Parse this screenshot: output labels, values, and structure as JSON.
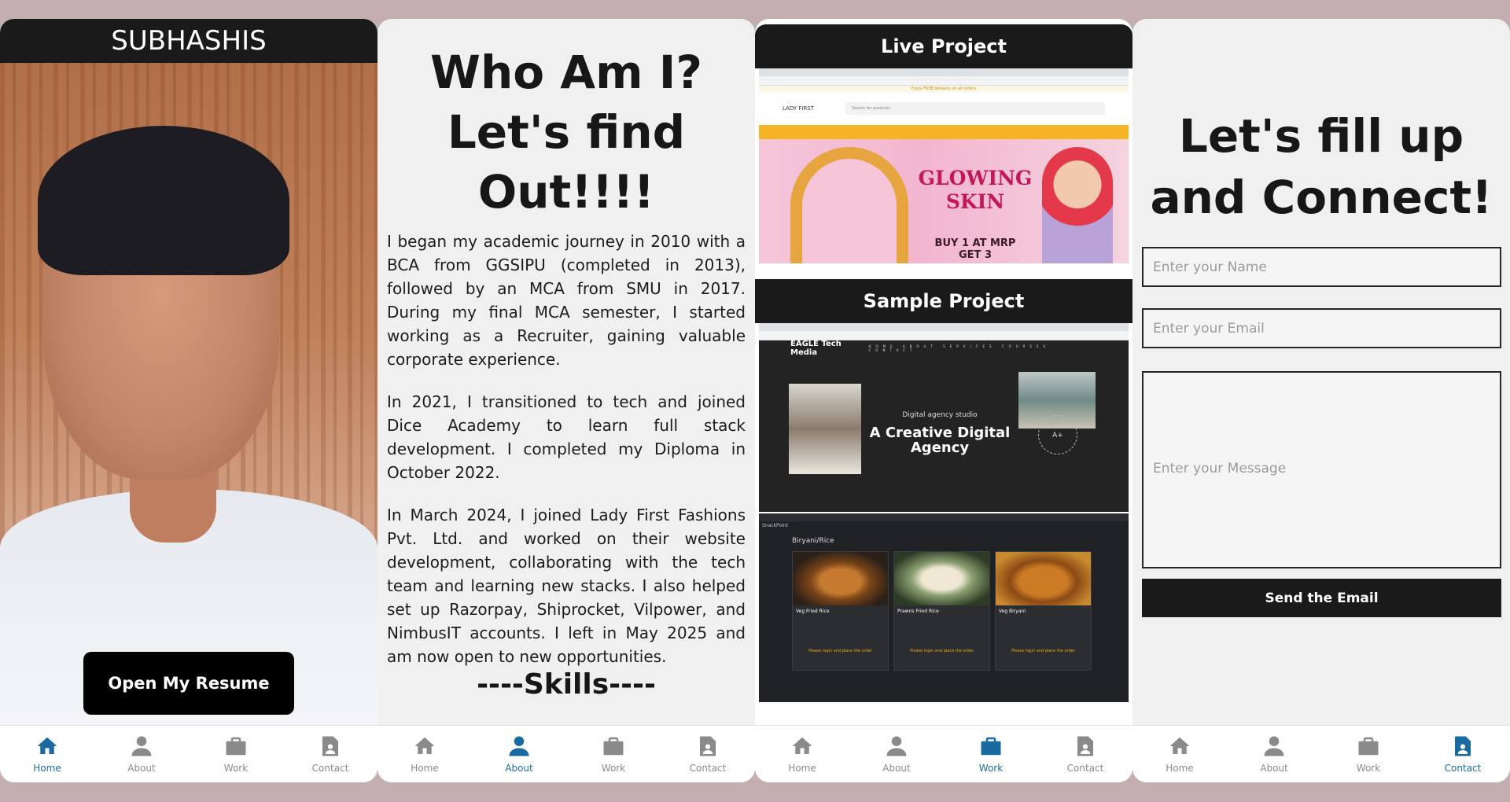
{
  "home": {
    "name": "SUBHASHIS",
    "resume_button": "Open My Resume"
  },
  "about": {
    "title_line1": "Who Am I?",
    "title_line2": "Let's find",
    "title_line3": "Out!!!!",
    "paragraphs": [
      "I began my academic journey in 2010 with a BCA from GGSIPU (completed in 2013), followed by an MCA from SMU in 2017. During my final MCA semester, I started working as a Recruiter, gaining valuable corporate experience.",
      "In 2021, I transitioned to tech and joined Dice Academy to learn full stack development. I completed my Diploma in October 2022.",
      "In March 2024, I joined Lady First Fashions Pvt. Ltd. and worked on their website development, collaborating with the tech team and learning new stacks. I also helped set up Razorpay, Shiprocket, Vilpower, and NimbusIT accounts. I left in May 2025 and am now open to new opportunities."
    ],
    "skills_heading": "----Skills----"
  },
  "work": {
    "live_label": "Live Project",
    "sample_label": "Sample Project",
    "live_site": {
      "top_notice": "Enjoy FREE delivery on all orders",
      "logo": "LADY FIRST",
      "search_placeholder": "Search for products",
      "banner_title_1": "GLOWING",
      "banner_title_2": "SKIN",
      "banner_offer_1": "BUY 1 AT MRP",
      "banner_offer_2": "GET 3"
    },
    "eagle_site": {
      "logo": "EAGLE Tech Media",
      "links": "HOME ABOUT SERVICES COURSES CONTACT",
      "subtitle": "Digital agency studio",
      "headline_1": "A Creative Digital",
      "headline_2": "Agency",
      "badge": "A+"
    },
    "snack_site": {
      "brand": "SnackPoint",
      "section": "Biryani/Rice",
      "items": [
        {
          "name": "Veg Fried Rice",
          "note": "Please login and place the order"
        },
        {
          "name": "Prawns Fried Rice",
          "note": "Please login and place the order"
        },
        {
          "name": "Veg Biryani",
          "note": "Please login and place the order"
        }
      ]
    }
  },
  "contact": {
    "title_line1": "Let's fill up",
    "title_line2": "and Connect!",
    "name_placeholder": "Enter your Name",
    "email_placeholder": "Enter your Email",
    "message_placeholder": "Enter your Message",
    "send_button": "Send the Email"
  },
  "nav": {
    "items": [
      {
        "label": "Home",
        "icon": "home-icon"
      },
      {
        "label": "About",
        "icon": "person-icon"
      },
      {
        "label": "Work",
        "icon": "briefcase-icon"
      },
      {
        "label": "Contact",
        "icon": "contact-card-icon"
      }
    ],
    "active_color": "#1a6aa2",
    "inactive_color": "#8a8a8a"
  }
}
